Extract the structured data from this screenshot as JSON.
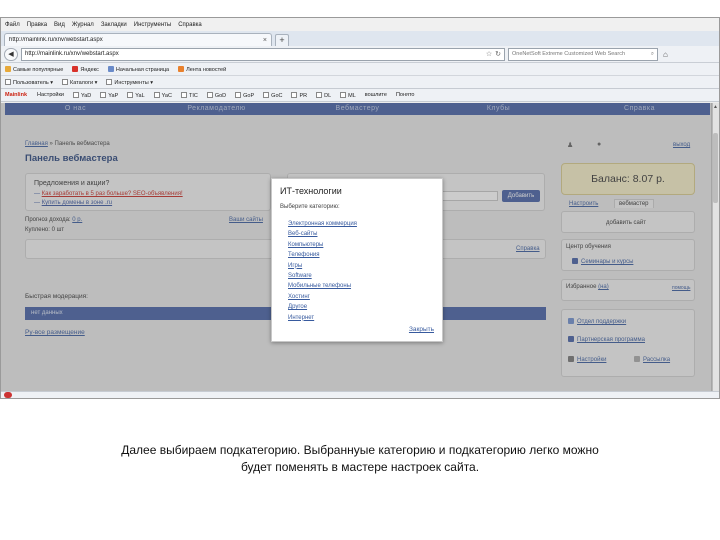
{
  "browser": {
    "menu": [
      "Файл",
      "Правка",
      "Вид",
      "Журнал",
      "Закладки",
      "Инструменты",
      "Справка"
    ],
    "tab_title": "http://mainlink.ru/xnv/webstart.aspx",
    "url": "http://mainlink.ru/xnv/webstart.aspx",
    "search_placeholder": "OneNetSoft Extreme Customized Web Search",
    "bookmarks": [
      "Самые популярные",
      "Яндекс",
      "Начальная страница",
      "Лента новостей"
    ],
    "toolbar2_items": [
      "Пользователь",
      "Каталоги",
      "Инструменты"
    ],
    "toolbar3_brand": "Mainlink",
    "toolbar3_items": [
      "Настройки",
      "YaD",
      "YaP",
      "YaL",
      "YaC",
      "TIC",
      "GoD",
      "GoP",
      "GoC",
      "PR",
      "DL",
      "ML",
      "вошлите",
      "Понято"
    ]
  },
  "site": {
    "nav": [
      "О нас",
      "Рекламодателю",
      "Вебмастеру",
      "Клубы",
      "Справка"
    ],
    "breadcrumb_link": "Главная",
    "breadcrumb_current": "Панель вебмастера",
    "page_title": "Панель вебмастера",
    "offers_title": "Предложения и акции?",
    "offer_1": "Как заработать в 5 раз больше? SEO-объявления!",
    "offer_2": "Купить домены в зоне .ru",
    "add_button": "Добавить",
    "income_forecast_label": "Прогноз дохода:",
    "income_forecast_value": "0 р.",
    "bought_label": "Куплено: 0 шт",
    "all_sites_link": "Ваши сайты",
    "help_link": "Справка",
    "quick_moderation": "Быстрая модерация:",
    "no_data": "нет данных",
    "ru_link": "Ру-все размещение",
    "login_link": "выход",
    "balance_label": "Баланс: 8.07 р.",
    "tab_settings": "Настроить",
    "tab_webmaster": "вебмастер",
    "add_site": "добавить сайт",
    "training_label": "Центр обучения",
    "seminars_link": "Семинары и курсы",
    "favorites_label": "Избранное",
    "favorites_count": "(на)",
    "help_small": "помощь",
    "support_link": "Отдел поддержки",
    "partner_link": "Партнерская программа",
    "settings_link": "Настройки",
    "newsletter_link": "Рассылка"
  },
  "modal": {
    "title": "ИТ-технологии",
    "subtitle": "Выберите категорию:",
    "categories": [
      "Электронная коммерция",
      "Веб-сайты",
      "Компьютеры",
      "Телефония",
      "Игры",
      "Software",
      "Мобильные телефоны",
      "Хостинг",
      "Другое",
      "Интернет"
    ],
    "close_label": "Закрыть"
  },
  "caption": {
    "line1": "Далее выбираем подкатегорию. Выбраннуые категорию и подкатегорию легко можно",
    "line2": "будет поменять в мастере настроек сайта."
  },
  "colors": {
    "site_blue": "#4661a6",
    "link_blue": "#375a9e",
    "balance_bg": "#f7efc8",
    "hot_red": "#c82a22"
  }
}
